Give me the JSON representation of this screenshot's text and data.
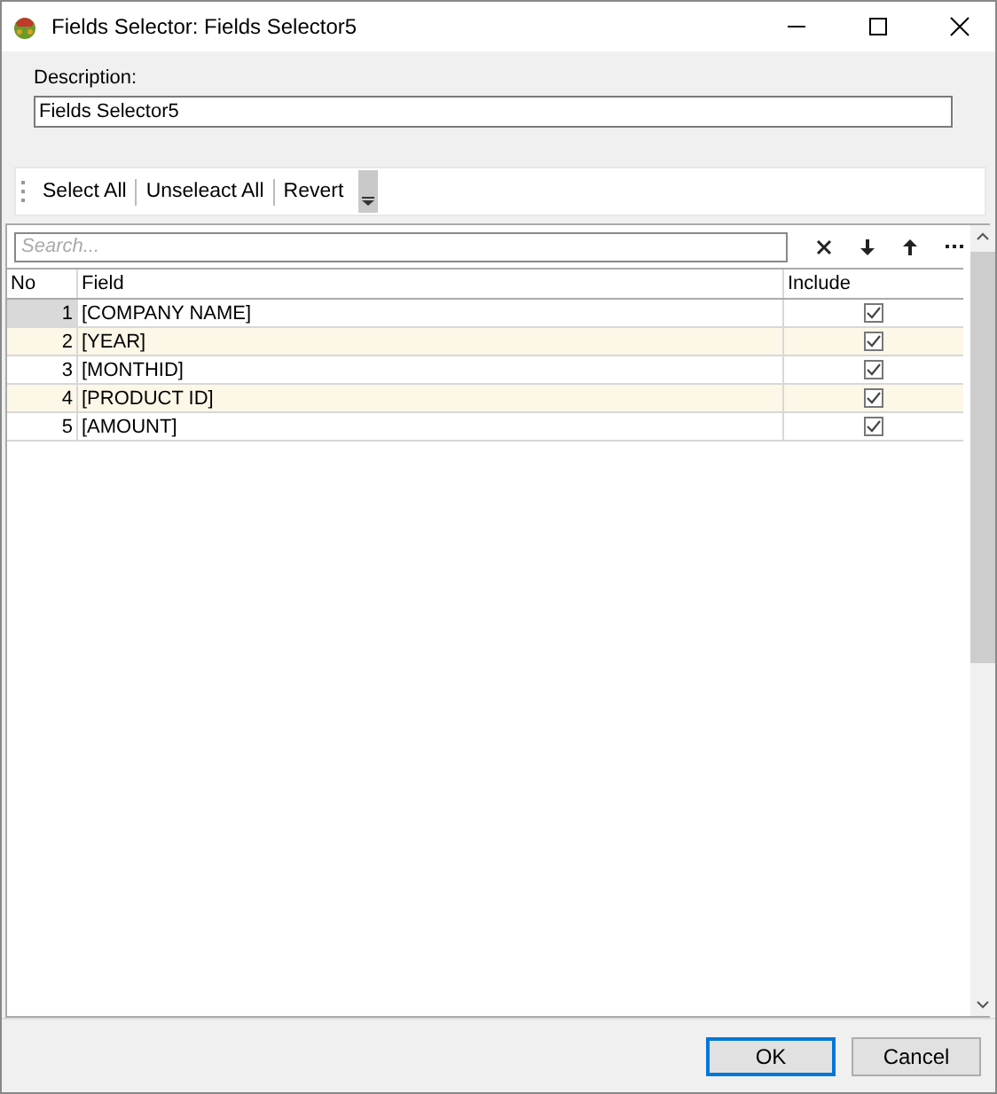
{
  "window": {
    "title": "Fields Selector: Fields Selector5"
  },
  "description": {
    "label": "Description:",
    "value": "Fields Selector5"
  },
  "toolbar": [
    "Select All",
    "Unseleact All",
    "Revert"
  ],
  "search": {
    "placeholder": "Search..."
  },
  "table": {
    "columns": [
      "No",
      "Field",
      "Include"
    ],
    "rows": [
      {
        "no": "1",
        "field": "[COMPANY NAME]",
        "include": true,
        "selected": true
      },
      {
        "no": "2",
        "field": "[YEAR]",
        "include": true,
        "selected": false
      },
      {
        "no": "3",
        "field": "[MONTHID]",
        "include": true,
        "selected": false
      },
      {
        "no": "4",
        "field": "[PRODUCT ID]",
        "include": true,
        "selected": false
      },
      {
        "no": "5",
        "field": "[AMOUNT]",
        "include": true,
        "selected": false
      }
    ]
  },
  "buttons": [
    "OK",
    "Cancel"
  ]
}
